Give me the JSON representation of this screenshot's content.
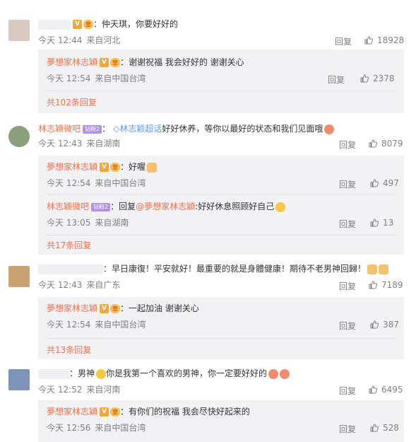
{
  "comments": [
    {
      "username": "",
      "text": "仲天琪，你要好好的",
      "time": "今天 12:44",
      "source": "来自河北",
      "reply_label": "回复",
      "likes": "18928",
      "replies": [
        {
          "username": "夢想家林志穎",
          "text": "谢谢祝福 我会好好的 谢谢关心",
          "time": "今天 12:54",
          "source": "来自中国台湾",
          "reply_label": "回复",
          "likes": "2378"
        }
      ],
      "more": "共102条回复"
    },
    {
      "username": "林志颖微吧",
      "level": "钻粉2",
      "topic": "林志颖超话",
      "text": "好好休养，等你以最好的状态和我们见面哦",
      "time": "今天 12:43",
      "source": "来自湖南",
      "reply_label": "回复",
      "likes": "8079",
      "replies": [
        {
          "username": "夢想家林志穎",
          "text": "好喔",
          "time": "今天 12:54",
          "source": "来自中国台湾",
          "reply_label": "回复",
          "likes": "497"
        },
        {
          "username": "林志颖微吧",
          "level": "钻粉2",
          "prefix": "回复",
          "mention": "@夢想家林志穎",
          "text": "好好休息照顾好自己",
          "time": "今天 13:05",
          "source": "来自湖南",
          "reply_label": "回复",
          "likes": "13"
        }
      ],
      "more": "共17条回复"
    },
    {
      "username": "",
      "text": "早日康復！平安就好！最重要的就是身體健康！期待不老男神回歸！",
      "time": "今天 12:43",
      "source": "来自广东",
      "reply_label": "回复",
      "likes": "7189",
      "replies": [
        {
          "username": "夢想家林志穎",
          "text": "一起加油 谢谢关心",
          "time": "今天 12:54",
          "source": "来自中国台湾",
          "reply_label": "回复",
          "likes": "387"
        }
      ],
      "more": "共13条回复"
    },
    {
      "username": "",
      "text_a": "男神",
      "text_b": "你是我第一个喜欢的男神，你一定要好好的",
      "time": "今天 12:52",
      "source": "来自河南",
      "reply_label": "回复",
      "likes": "6495",
      "replies": [
        {
          "username": "夢想家林志穎",
          "text": "有你们的祝福 我会尽快好起来的",
          "time": "今天 12:56",
          "source": "来自中国台湾",
          "reply_label": "回复",
          "likes": "528"
        }
      ]
    }
  ],
  "icons": {
    "verified": "V",
    "crown": "皇",
    "like": "thumbs-up-icon"
  },
  "colors": {
    "username": "#eb7350",
    "meta": "#808080",
    "reply_bg": "#f2f2f5",
    "topic": "#5d9cec"
  }
}
